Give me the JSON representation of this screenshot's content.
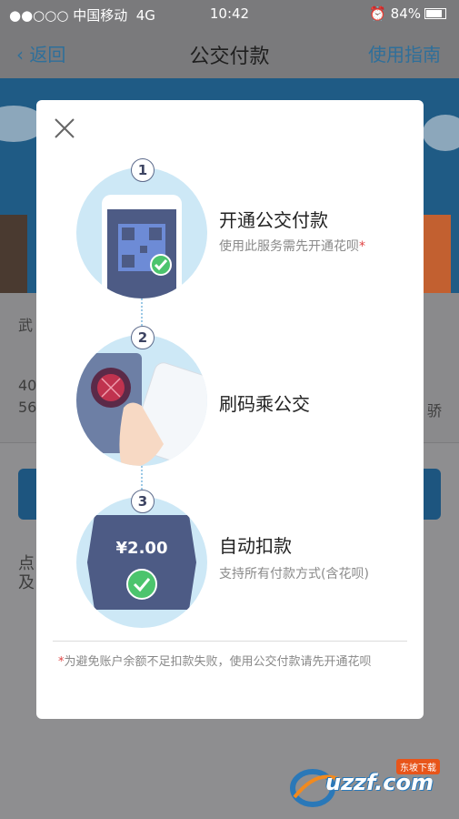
{
  "status_bar": {
    "carrier": "●●○○○ 中国移动",
    "network": "4G",
    "time": "10:42",
    "battery": "84%"
  },
  "nav": {
    "back_label": "返回",
    "title": "公交付款",
    "guide_label": "使用指南"
  },
  "background": {
    "row1": "武",
    "row2_line1": "40",
    "row2_line2": "56",
    "row2_right": "骄",
    "row3_line1": "点",
    "row3_line2": "及"
  },
  "modal": {
    "steps": [
      {
        "num": "1",
        "title": "开通公交付款",
        "desc": "使用此服务需先开通花呗",
        "desc_mark": "*"
      },
      {
        "num": "2",
        "title": "刷码乘公交",
        "desc": ""
      },
      {
        "num": "3",
        "title": "自动扣款",
        "desc": "支持所有付款方式(含花呗)",
        "amount": "¥2.00"
      }
    ],
    "footnote_mark": "*",
    "footnote": "为避免账户余额不足扣款失败，使用公交付款请先开通花呗"
  },
  "watermark": {
    "brand": "uzzf.com",
    "tag": "东坡下载"
  },
  "colors": {
    "accent": "#2f6f9a",
    "step_bg": "#cde8f6",
    "phone": "#4d5b85",
    "check": "#4cc46d"
  }
}
